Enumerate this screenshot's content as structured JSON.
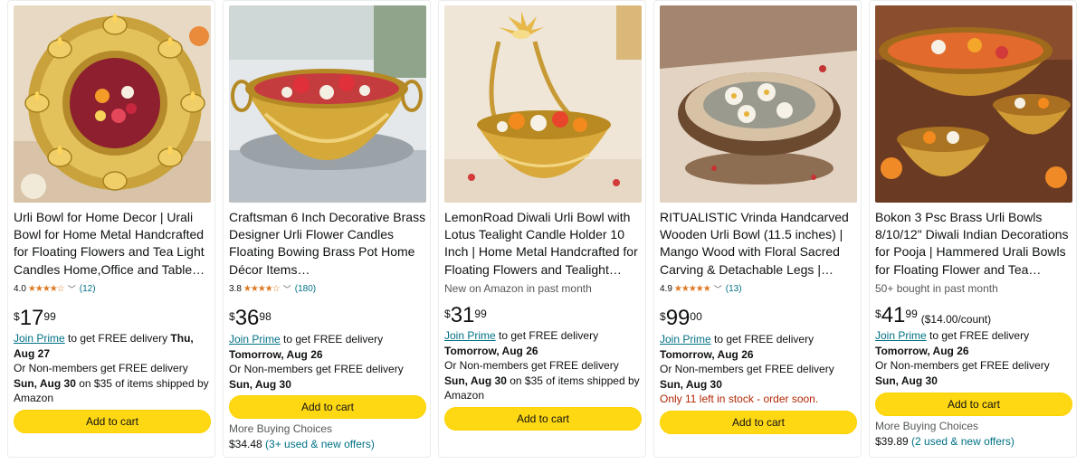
{
  "products": [
    {
      "title": "Urli Bowl for Home Decor | Urali Bowl for Home Metal Handcrafted for Floating Flowers and Tea Light Candles Home,Office and Table…",
      "rating": "4.0",
      "stars": "★★★★☆",
      "review_count": "(12)",
      "price_symbol": "$",
      "price_whole": "17",
      "price_fraction": "99",
      "join_prime": "Join Prime",
      "prime_text": " to get FREE delivery ",
      "prime_date": "Thu, Aug 27",
      "nonmember_text": "Or Non-members get FREE delivery ",
      "nonmember_date": "Sun, Aug 30",
      "nonmember_suffix": " on $35 of items shipped by Amazon",
      "button": "Add to cart"
    },
    {
      "title": "Craftsman 6 Inch Decorative Brass Designer Urli Flower Candles Floating Bowing Brass Pot Home Décor Items…",
      "rating": "3.8",
      "stars": "★★★★☆",
      "review_count": "(180)",
      "price_symbol": "$",
      "price_whole": "36",
      "price_fraction": "98",
      "join_prime": "Join Prime",
      "prime_text": " to get FREE delivery",
      "prime_date": "Tomorrow, Aug 26",
      "nonmember_text": "Or Non-members get FREE delivery ",
      "nonmember_date": "Sun, Aug 30",
      "button": "Add to cart",
      "more_choices": "More Buying Choices",
      "more_price": "$34.48",
      "more_offers": "(3+ used & new offers)"
    },
    {
      "title": "LemonRoad Diwali Urli Bowl with Lotus Tealight Candle Holder 10 Inch | Home Metal Handcrafted for Floating Flowers and Tealight…",
      "new_label": "New on Amazon in past month",
      "price_symbol": "$",
      "price_whole": "31",
      "price_fraction": "99",
      "join_prime": "Join Prime",
      "prime_text": " to get FREE delivery",
      "prime_date": "Tomorrow, Aug 26",
      "nonmember_text": "Or Non-members get FREE delivery ",
      "nonmember_date": "Sun, Aug 30",
      "nonmember_suffix": " on $35 of items shipped by Amazon",
      "button": "Add to cart"
    },
    {
      "title": "RITUALISTIC Vrinda Handcarved Wooden Urli Bowl (11.5 inches) | Mango Wood with Floral Sacred Carving & Detachable Legs | Floati…",
      "rating": "4.9",
      "stars": "★★★★★",
      "review_count": "(13)",
      "price_symbol": "$",
      "price_whole": "99",
      "price_fraction": "00",
      "join_prime": "Join Prime",
      "prime_text": " to get FREE delivery",
      "prime_date": "Tomorrow, Aug 26",
      "nonmember_text": "Or Non-members get FREE delivery ",
      "nonmember_date": "Sun, Aug 30",
      "stock": "Only 11 left in stock - order soon.",
      "button": "Add to cart"
    },
    {
      "title": "Bokon 3 Psc Brass Urli Bowls 8/10/12\" Diwali Indian Decorations for Pooja | Hammered Urali Bowls for Floating Flower and Tea Candle…",
      "bought_label": "50+ bought in past month",
      "price_symbol": "$",
      "price_whole": "41",
      "price_fraction": "99",
      "price_unit": "($14.00/count)",
      "join_prime": "Join Prime",
      "prime_text": " to get FREE delivery",
      "prime_date": "Tomorrow, Aug 26",
      "nonmember_text": "Or Non-members get FREE delivery ",
      "nonmember_date": "Sun, Aug 30",
      "button": "Add to cart",
      "more_choices": "More Buying Choices",
      "more_price": "$39.89",
      "more_offers": "(2 used & new offers)"
    }
  ],
  "colors": {
    "button": "#ffd814",
    "link": "#007185",
    "star": "#de7921",
    "stock": "#b12704"
  }
}
